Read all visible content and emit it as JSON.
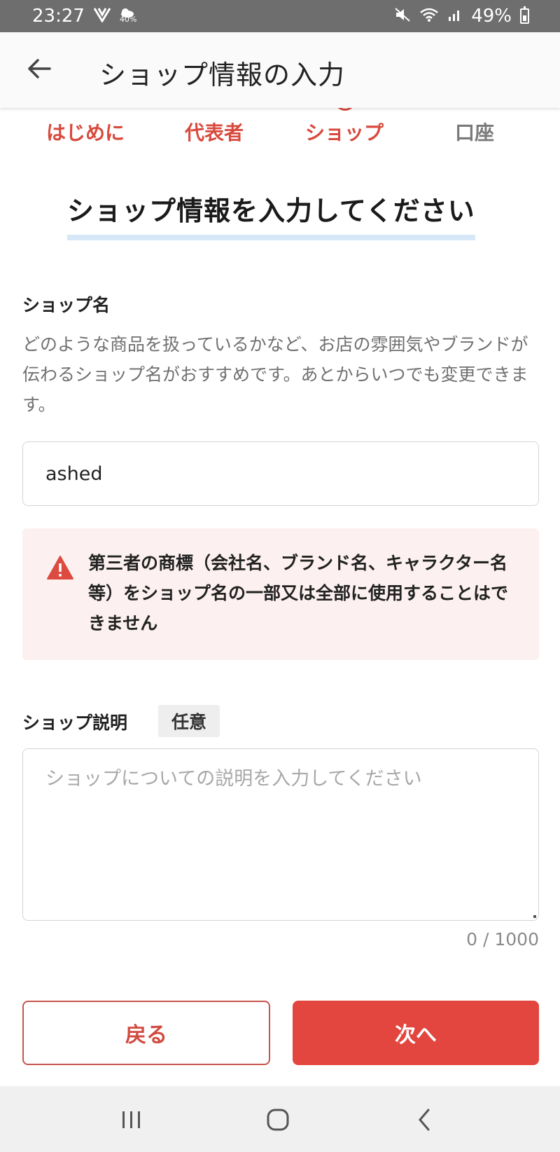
{
  "status_bar": {
    "time": "23:27",
    "small_badge": "40%",
    "battery": "49%"
  },
  "app_bar": {
    "title": "ショップ情報の入力"
  },
  "steps": [
    {
      "label": "はじめに",
      "state": "done"
    },
    {
      "label": "代表者",
      "state": "done"
    },
    {
      "label": "ショップ",
      "state": "current"
    },
    {
      "label": "口座",
      "state": "pending"
    }
  ],
  "heading": "ショップ情報を入力してください",
  "shop_name": {
    "label": "ショップ名",
    "helper": "どのような商品を扱っているかなど、お店の雰囲気やブランドが伝わるショップ名がおすすめです。あとからいつでも変更できます。",
    "value": "ashed"
  },
  "warning": {
    "text": "第三者の商標（会社名、ブランド名、キャラクター名等）をショップ名の一部又は全部に使用することはできません"
  },
  "description": {
    "label": "ショップ説明",
    "optional_badge": "任意",
    "placeholder": "ショップについての説明を入力してください",
    "counter": "0 / 1000"
  },
  "buttons": {
    "back": "戻る",
    "next": "次へ"
  },
  "colors": {
    "accent": "#e2463f",
    "warning_bg": "#fcf1f0",
    "heading_underline": "#d6e8f8"
  }
}
